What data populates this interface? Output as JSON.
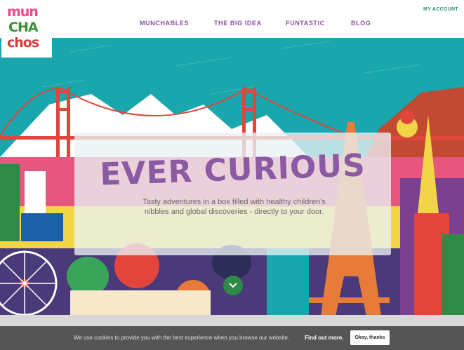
{
  "header": {
    "logo": {
      "line1": "mun",
      "line2": "CHA",
      "line3": "chos"
    },
    "account_link": "MY ACCOUNT",
    "nav": [
      {
        "label": "MUNCHABLES"
      },
      {
        "label": "THE BIG IDEA"
      },
      {
        "label": "FUNTASTIC"
      },
      {
        "label": "BLOG"
      }
    ]
  },
  "hero": {
    "headline": "EVER CURIOUS",
    "tagline": "Tasty adventures in a box filled with healthy children's nibbles and global discoveries - directly to your door.",
    "scroll_icon": "chevron-down-icon"
  },
  "cookie_banner": {
    "text": "We use cookies to provide you with the best experience when you browse our website.",
    "link": "Find out more.",
    "button": "Okay, thanks"
  },
  "colors": {
    "sky": "#1aa6ad",
    "brand_purple": "#8b5aa2",
    "brand_green": "#2f8a48",
    "cookie_bg": "#555555"
  }
}
